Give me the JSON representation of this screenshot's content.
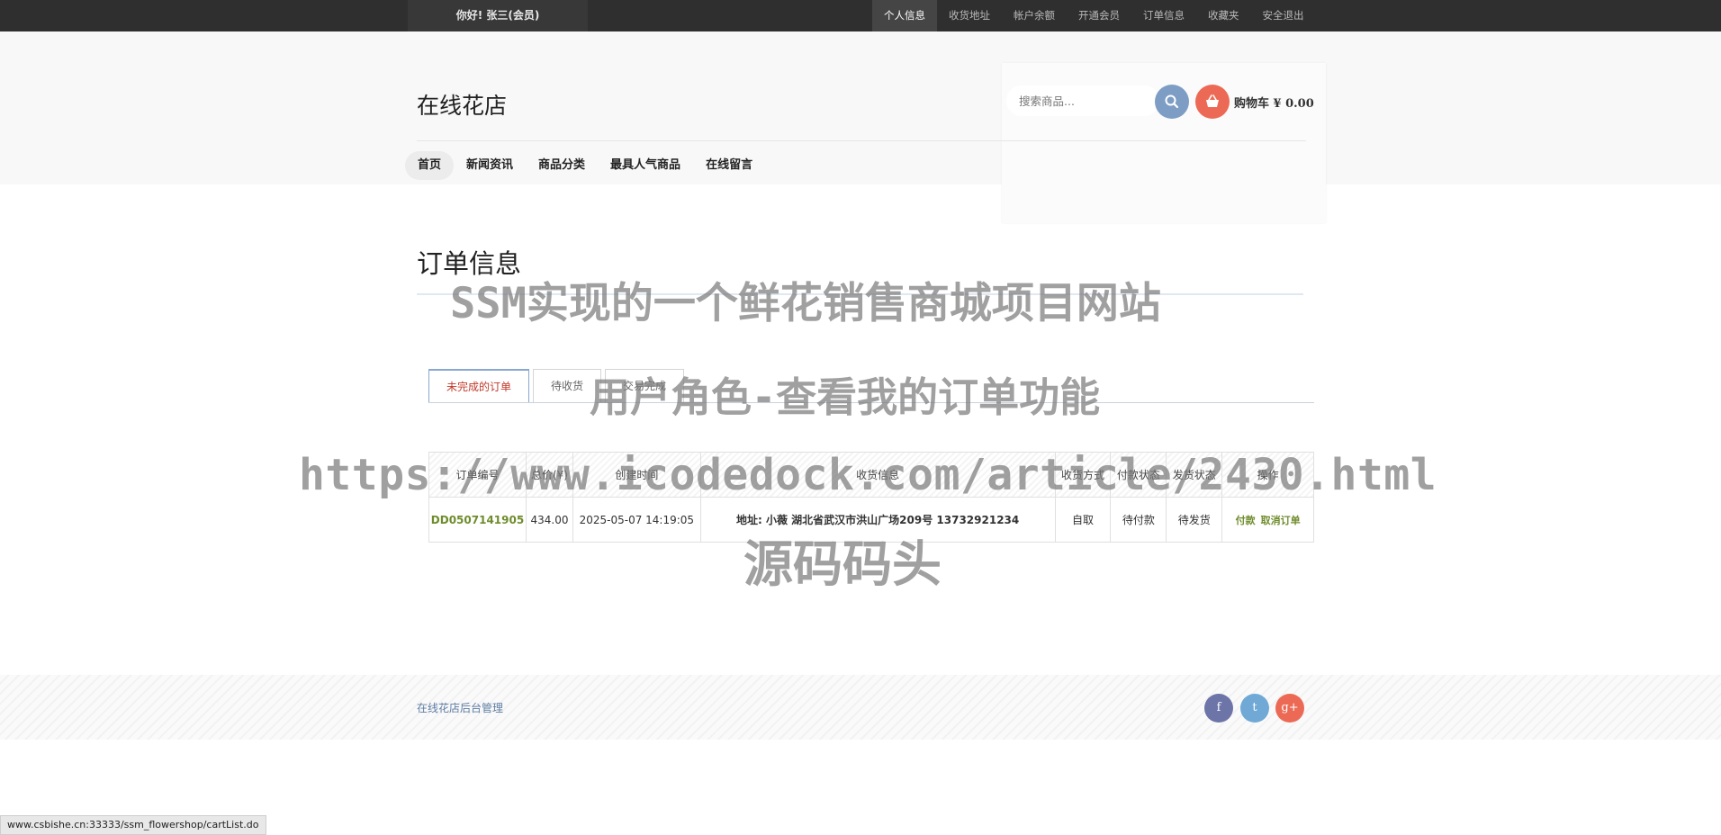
{
  "topbar": {
    "greeting": "你好!  张三(会员)",
    "nav": [
      {
        "label": "个人信息"
      },
      {
        "label": "收货地址"
      },
      {
        "label": "帐户余额"
      },
      {
        "label": "开通会员"
      },
      {
        "label": "订单信息"
      },
      {
        "label": "收藏夹"
      },
      {
        "label": "安全退出"
      }
    ]
  },
  "header": {
    "logo": "在线花店",
    "search_placeholder": "搜索商品...",
    "cart_label": "购物车 ¥ 0.00",
    "nav": [
      {
        "label": "首页"
      },
      {
        "label": "新闻资讯"
      },
      {
        "label": "商品分类"
      },
      {
        "label": "最具人气商品"
      },
      {
        "label": "在线留言"
      }
    ]
  },
  "main": {
    "title": "订单信息",
    "tabs": [
      {
        "label": "未完成的订单"
      },
      {
        "label": "待收货"
      },
      {
        "label": "交易完成"
      }
    ],
    "table": {
      "headers": [
        "订单编号",
        "总价(¥)",
        "创建时间",
        "收货信息",
        "收货方式",
        "付款状态",
        "发货状态",
        "操作"
      ],
      "rows": [
        {
          "order_no": "DD0507141905",
          "total": "434.00",
          "created": "2025-05-07 14:19:05",
          "address": "地址: 小薇    湖北省武汉市洪山广场209号    13732921234",
          "delivery": "自取",
          "pay_status": "待付款",
          "ship_status": "待发货",
          "actions": [
            "付款",
            "取消订单"
          ]
        }
      ]
    }
  },
  "footer": {
    "admin_link": "在线花店后台管理",
    "social": [
      "f",
      "t",
      "g+"
    ]
  },
  "watermark": {
    "line1": "SSM实现的一个鲜花销售商城项目网站",
    "line2": "用户角色-查看我的订单功能",
    "line3": "https://www.icodedock.com/article/2430.html",
    "line4": "源码码头"
  },
  "status_url": "www.csbishe.cn:33333/ssm_flowershop/cartList.do"
}
